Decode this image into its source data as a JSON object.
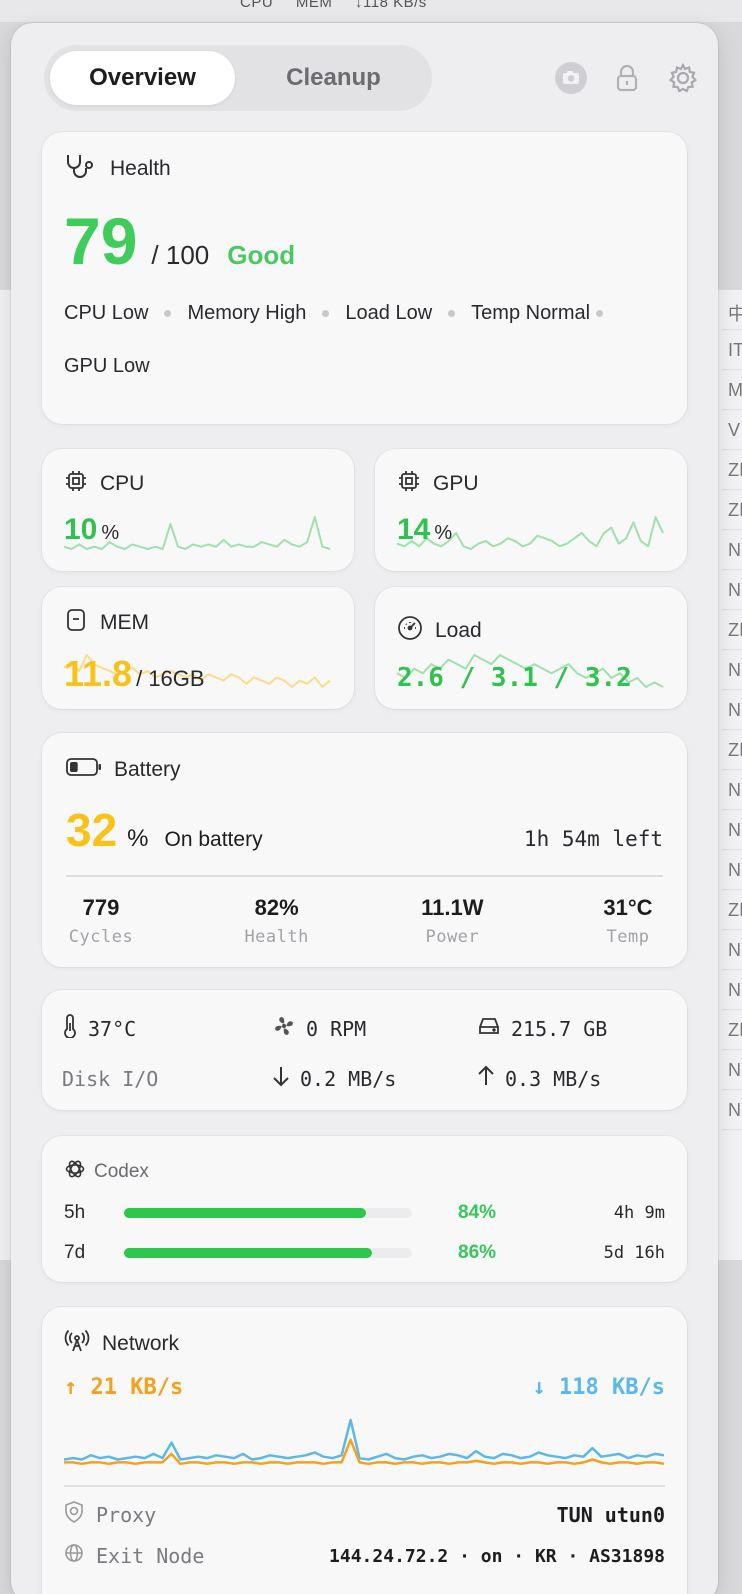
{
  "menubar": {
    "cpu": "CPU",
    "mem": "MEM",
    "net": "↓118 KB/s"
  },
  "background_rows": [
    "中",
    "IT",
    "MI",
    "V",
    "ZI",
    "ZI",
    "N",
    "N",
    "ZI",
    "N",
    "N",
    "ZI",
    "N",
    "N",
    "N",
    "ZI",
    "N",
    "N",
    "ZI",
    "N",
    "N"
  ],
  "tabs": [
    {
      "label": "Overview",
      "active": true
    },
    {
      "label": "Cleanup",
      "active": false
    }
  ],
  "top_icons": [
    "camera-icon",
    "lock-icon",
    "gear-icon"
  ],
  "health": {
    "title": "Health",
    "score": "79",
    "of": "/ 100",
    "rating": "Good",
    "chips": [
      "CPU Low",
      "Memory High",
      "Load Low",
      "Temp Normal",
      "GPU Low"
    ]
  },
  "cpu": {
    "title": "CPU",
    "value": "10",
    "unit": "%",
    "spark": [
      6,
      5,
      7,
      5,
      6,
      5,
      8,
      6,
      5,
      7,
      6,
      5,
      6,
      5,
      16,
      6,
      5,
      7,
      6,
      7,
      6,
      9,
      6,
      7,
      6,
      6,
      8,
      7,
      6,
      9,
      7,
      6,
      8,
      19,
      6,
      5
    ]
  },
  "gpu": {
    "title": "GPU",
    "value": "14",
    "unit": "%",
    "spark": [
      8,
      7,
      9,
      7,
      10,
      8,
      7,
      9,
      12,
      7,
      6,
      8,
      9,
      7,
      8,
      10,
      9,
      7,
      8,
      11,
      10,
      9,
      7,
      8,
      10,
      12,
      9,
      7,
      12,
      14,
      8,
      10,
      16,
      9,
      7,
      18,
      12
    ]
  },
  "mem": {
    "title": "MEM",
    "value": "11.8",
    "unit": "/ 16GB",
    "spark": [
      10,
      12,
      9,
      14,
      11,
      10,
      9,
      8,
      9,
      10,
      8,
      9,
      7,
      8,
      9,
      8,
      7,
      8,
      6,
      8,
      7,
      6,
      8,
      7,
      5,
      7,
      6,
      5,
      7,
      6,
      4,
      6,
      5,
      7,
      4,
      6
    ]
  },
  "load": {
    "title": "Load",
    "value": "2.6 / 3.1 / 3.2",
    "spark": [
      8,
      7,
      9,
      8,
      10,
      9,
      11,
      10,
      9,
      12,
      11,
      10,
      12,
      11,
      10,
      9,
      10,
      9,
      8,
      9,
      10,
      8,
      7,
      8,
      9,
      7,
      8,
      6,
      7,
      5,
      6,
      5
    ]
  },
  "battery": {
    "title": "Battery",
    "percent": "32",
    "pct_sign": "%",
    "status": "On battery",
    "time_left": "1h 54m left",
    "level": 0.32,
    "stats": [
      {
        "value": "779",
        "label": "Cycles"
      },
      {
        "value": "82%",
        "label": "Health"
      },
      {
        "value": "11.1W",
        "label": "Power"
      },
      {
        "value": "31°C",
        "label": "Temp"
      }
    ]
  },
  "system": {
    "temp": "37°C",
    "fan": "0 RPM",
    "disk": "215.7 GB",
    "disk_io_label": "Disk I/O",
    "read": "0.2 MB/s",
    "write": "0.3 MB/s"
  },
  "codex": {
    "title": "Codex",
    "rows": [
      {
        "label": "5h",
        "percent": "84%",
        "level": 0.84,
        "time": "4h 9m"
      },
      {
        "label": "7d",
        "percent": "86%",
        "level": 0.86,
        "time": "5d 16h"
      }
    ]
  },
  "network": {
    "title": "Network",
    "up": "21  KB/s",
    "down": "118 KB/s",
    "down_series": [
      6,
      7,
      6,
      9,
      7,
      8,
      6,
      7,
      8,
      7,
      10,
      7,
      18,
      6,
      7,
      8,
      7,
      9,
      8,
      7,
      10,
      6,
      7,
      9,
      8,
      7,
      8,
      9,
      11,
      8,
      7,
      9,
      34,
      7,
      6,
      8,
      10,
      7,
      6,
      8,
      9,
      7,
      8,
      10,
      9,
      7,
      12,
      8,
      7,
      10,
      9,
      7,
      8,
      11,
      9,
      8,
      7,
      9,
      8,
      14,
      8,
      9,
      10,
      7,
      9,
      8,
      10,
      9
    ],
    "up_series": [
      4,
      4,
      3,
      4,
      4,
      3,
      4,
      4,
      3,
      4,
      4,
      4,
      10,
      3,
      4,
      4,
      3,
      4,
      4,
      3,
      4,
      4,
      3,
      4,
      4,
      3,
      4,
      4,
      4,
      3,
      4,
      4,
      20,
      4,
      3,
      4,
      4,
      3,
      4,
      4,
      3,
      4,
      4,
      3,
      4,
      4,
      5,
      4,
      3,
      4,
      4,
      3,
      4,
      4,
      3,
      4,
      4,
      3,
      4,
      6,
      4,
      3,
      4,
      4,
      3,
      4,
      4,
      3
    ],
    "proxy_label": "Proxy",
    "proxy_value": "TUN utun0",
    "exit_label": "Exit Node",
    "exit_value": "144.24.72.2 · on · KR · AS31898"
  }
}
